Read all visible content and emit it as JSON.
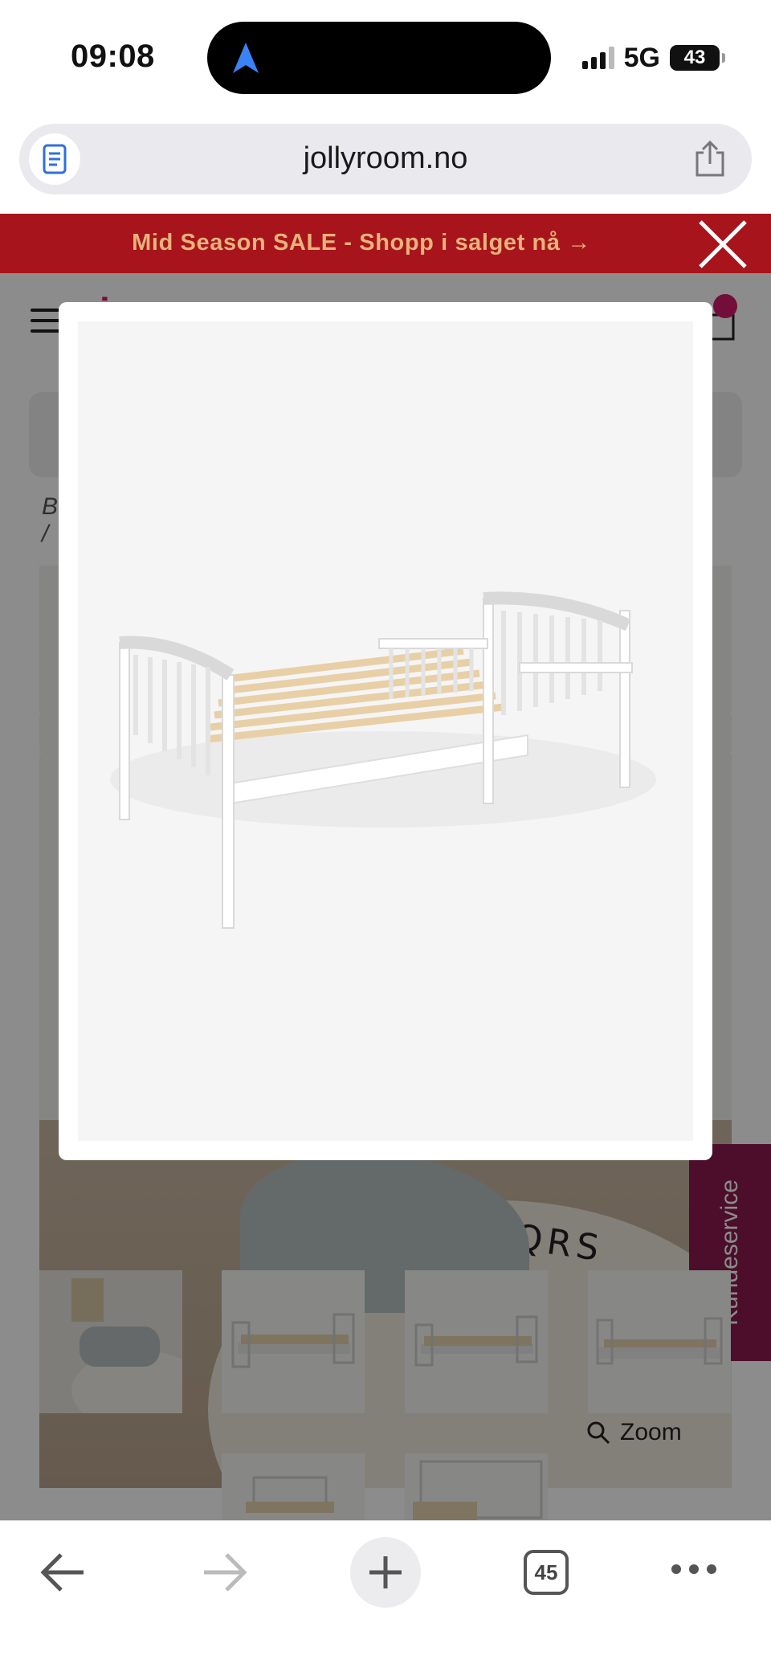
{
  "status_bar": {
    "time": "09:08",
    "network": "5G",
    "battery": "43",
    "icons": [
      "location-arrow-icon",
      "signal-bars-icon",
      "battery-icon"
    ]
  },
  "browser": {
    "url": "jollyroom.no",
    "open_tabs": "45",
    "icons": [
      "reader-doc-icon",
      "share-icon",
      "back-arrow-icon",
      "forward-arrow-icon",
      "plus-icon",
      "tabs-icon",
      "more-icon"
    ]
  },
  "page": {
    "promo_text": "Mid Season SALE - Shopp i salget nå →",
    "breadcrumb_start": "B",
    "breadcrumb_sep": "/",
    "side_tab_label": "Kundeservice",
    "zoom_label": "Zoom",
    "rug_letters": "NOPQRS",
    "accent_color": "#a8141b",
    "promo_text_color": "#e7b27b",
    "brand_color": "#d11b6b",
    "side_tab_color": "#8a1b4d"
  },
  "modal": {
    "image_subject": "white toddler bed with wooden slats"
  }
}
